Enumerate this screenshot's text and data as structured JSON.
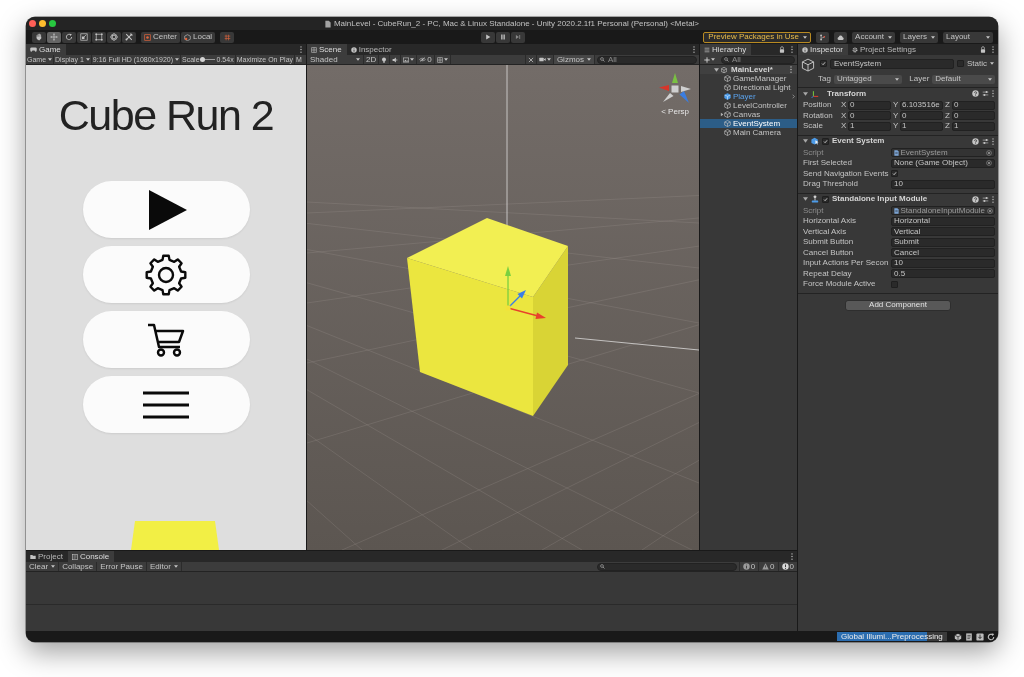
{
  "window": {
    "title": "MainLevel - CubeRun_2 - PC, Mac & Linux Standalone - Unity 2020.2.1f1 Personal (Personal) <Metal>"
  },
  "toolbar": {
    "tools": [
      {
        "selected": false
      },
      {
        "selected": true
      },
      {
        "selected": false
      },
      {
        "selected": false
      },
      {
        "selected": false
      },
      {
        "selected": false
      },
      {
        "selected": false
      }
    ],
    "pivot": [
      {
        "label": "Center"
      },
      {
        "label": "Local"
      }
    ],
    "preview_packages": "Preview Packages in Use",
    "account": "Account",
    "layers": "Layers",
    "layout": "Layout"
  },
  "game": {
    "tabs": [
      {
        "label": "Game",
        "selected": true
      }
    ],
    "mode": "Game",
    "display": "Display 1",
    "resolution": "9:16 Full HD (1080x1920)",
    "scale_label": "Scale",
    "scale": {
      "level": 0.1
    },
    "scale_value": "0.54x",
    "maximize": "Maximize On Play",
    "cut_option": "M",
    "title": "Cube Run 2"
  },
  "scene": {
    "tabs": [
      {
        "label": "Scene",
        "selected": true
      },
      {
        "label": "Inspector",
        "selected": false
      }
    ],
    "shading": "Shaded",
    "mode_2d": "2D",
    "hidden_count": "0",
    "gizmos": "Gizmos",
    "search": {
      "placeholder": "All"
    },
    "projection": "< Persp"
  },
  "hierarchy": {
    "tabs": [
      {
        "label": "Hierarchy",
        "selected": true
      }
    ],
    "search": {
      "placeholder": "All"
    },
    "scene": {
      "label": "MainLevel*",
      "expanded": true,
      "children": [
        {
          "label": "GameManager",
          "kind": "object",
          "selected": false
        },
        {
          "label": "Directional Light",
          "kind": "object",
          "selected": false
        },
        {
          "label": "Player",
          "kind": "prefab",
          "selected": false
        },
        {
          "label": "LevelController",
          "kind": "object",
          "selected": false
        },
        {
          "label": "Canvas",
          "kind": "group",
          "selected": false
        },
        {
          "label": "EventSystem",
          "kind": "object",
          "selected": true
        },
        {
          "label": "Main Camera",
          "kind": "object",
          "selected": false
        }
      ]
    }
  },
  "inspector": {
    "tabs": [
      {
        "label": "Inspector",
        "selected": true
      },
      {
        "label": "Project Settings",
        "selected": false
      }
    ],
    "object": {
      "active": true,
      "name": "EventSystem",
      "static": false,
      "static_label": "Static",
      "tag_label": "Tag",
      "tag": "Untagged",
      "layer_label": "Layer",
      "layer": "Default"
    },
    "transform": {
      "title": "Transform",
      "expanded": true,
      "rows": [
        {
          "label": "Position",
          "values": [
            {
              "axis": "X",
              "value": "0"
            },
            {
              "axis": "Y",
              "value": "6.103516e"
            },
            {
              "axis": "Z",
              "value": "0"
            }
          ]
        },
        {
          "label": "Rotation",
          "values": [
            {
              "axis": "X",
              "value": "0"
            },
            {
              "axis": "Y",
              "value": "0"
            },
            {
              "axis": "Z",
              "value": "0"
            }
          ]
        },
        {
          "label": "Scale",
          "values": [
            {
              "axis": "X",
              "value": "1"
            },
            {
              "axis": "Y",
              "value": "1"
            },
            {
              "axis": "Z",
              "value": "1"
            }
          ]
        }
      ]
    },
    "components": [
      {
        "title": "Event System",
        "enabled": true,
        "expanded": true,
        "fields": [
          {
            "kind": "script",
            "label": "Script",
            "value": "EventSystem"
          },
          {
            "kind": "object",
            "label": "First Selected",
            "value": "None (Game Object)"
          },
          {
            "kind": "toggle",
            "label": "Send Navigation Events",
            "checked": true
          },
          {
            "kind": "text",
            "label": "Drag Threshold",
            "value": "10"
          }
        ]
      },
      {
        "title": "Standalone Input Module",
        "enabled": true,
        "expanded": true,
        "fields": [
          {
            "kind": "script",
            "label": "Script",
            "value": "StandaloneInputModule"
          },
          {
            "kind": "text",
            "label": "Horizontal Axis",
            "value": "Horizontal"
          },
          {
            "kind": "text",
            "label": "Vertical Axis",
            "value": "Vertical"
          },
          {
            "kind": "text",
            "label": "Submit Button",
            "value": "Submit"
          },
          {
            "kind": "text",
            "label": "Cancel Button",
            "value": "Cancel"
          },
          {
            "kind": "text",
            "label": "Input Actions Per Secon",
            "value": "10"
          },
          {
            "kind": "text",
            "label": "Repeat Delay",
            "value": "0.5"
          },
          {
            "kind": "toggle",
            "label": "Force Module Active",
            "checked": false
          }
        ]
      }
    ],
    "add_component": "Add Component"
  },
  "console": {
    "tabs": [
      {
        "label": "Project",
        "selected": false
      },
      {
        "label": "Console",
        "selected": true
      }
    ],
    "clear": "Clear",
    "collapse": "Collapse",
    "error_pause": "Error Pause",
    "editor": "Editor",
    "counts": [
      "0",
      "0",
      "0"
    ]
  },
  "status_bar": {
    "progress": {
      "label": "Global Illumi...Preprocessing",
      "level": 0.82
    }
  }
}
